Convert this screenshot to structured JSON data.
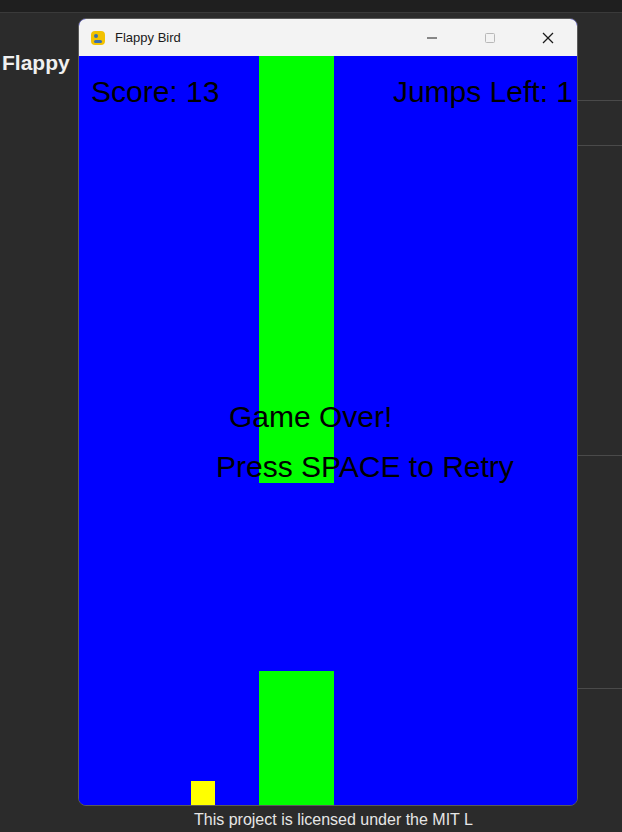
{
  "page": {
    "heading": "Flappy",
    "footer_text": "This project is licensed under the MIT L"
  },
  "window": {
    "title": "Flappy Bird",
    "controls": [
      {
        "kind": "minimize",
        "disabled": false
      },
      {
        "kind": "maximize",
        "disabled": true
      },
      {
        "kind": "close",
        "disabled": false
      }
    ]
  },
  "game": {
    "score": "Score: 13",
    "jumps": "Jumps Left: 1",
    "message": "Game Over!",
    "prompt": "Press SPACE to Retry",
    "game_over": true
  }
}
